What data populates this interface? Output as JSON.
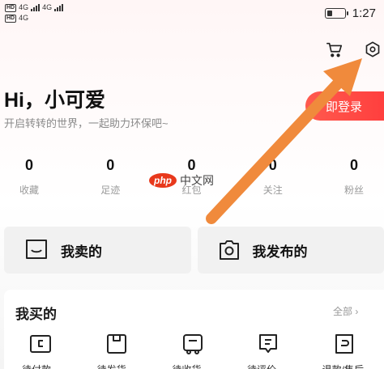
{
  "status_bar": {
    "network1": "4G",
    "network2": "4G",
    "time": "1:27",
    "battery_level": 0.3
  },
  "header": {
    "cart_icon": "cart-icon",
    "settings_icon": "settings-hexagon-icon"
  },
  "profile": {
    "greeting": "Hi，小可爱",
    "subtitle": "开启转转的世界，一起助力环保吧~",
    "login_label": "即登录"
  },
  "stats": [
    {
      "value": "0",
      "label": "收藏"
    },
    {
      "value": "0",
      "label": "足迹"
    },
    {
      "value": "0",
      "label": "红包"
    },
    {
      "value": "0",
      "label": "关注"
    },
    {
      "value": "0",
      "label": "粉丝"
    }
  ],
  "actions": {
    "sold_label": "我卖的",
    "published_label": "我发布的"
  },
  "bought": {
    "title": "我买的",
    "all_label": "全部 ›",
    "items": [
      {
        "label": "待付款",
        "icon": "wallet-icon"
      },
      {
        "label": "待发货",
        "icon": "package-icon"
      },
      {
        "label": "待收货",
        "icon": "truck-icon"
      },
      {
        "label": "待评价",
        "icon": "comment-icon"
      },
      {
        "label": "退款/售后",
        "icon": "refund-icon"
      }
    ]
  },
  "watermark": {
    "logo": "php",
    "site": "中文网"
  },
  "colors": {
    "accent": "#ff4a3f",
    "annotation_arrow": "#f08a3c"
  }
}
